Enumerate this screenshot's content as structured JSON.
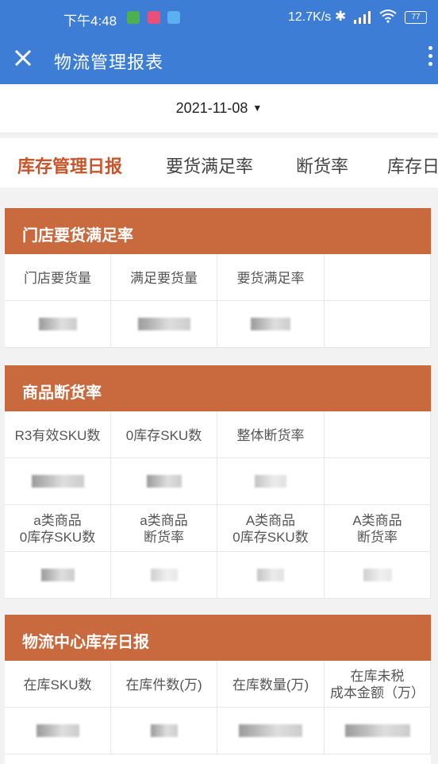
{
  "status_bar": {
    "time": "下午4:48",
    "speed": "12.7K/s",
    "battery": "77",
    "icons": [
      "app-green-icon",
      "app-pink-icon",
      "app-blue-icon",
      "bluetooth-icon",
      "signal-icon",
      "wifi-icon",
      "battery-icon"
    ]
  },
  "app_bar": {
    "title": "物流管理报表",
    "close_icon": "close-icon",
    "more_icon": "more-vertical-icon"
  },
  "date_selector": {
    "value": "2021-11-08",
    "caret": "▼"
  },
  "tabs": [
    {
      "label": "库存管理日报",
      "active": true
    },
    {
      "label": "要货满足率",
      "active": false
    },
    {
      "label": "断货率",
      "active": false
    },
    {
      "label": "库存日",
      "active": false
    }
  ],
  "sections": {
    "store_fill": {
      "title": "门店要货满足率",
      "headers": [
        "门店要货量",
        "满足要货量",
        "要货满足率"
      ]
    },
    "stockout": {
      "title": "商品断货率",
      "headers": [
        "R3有效SKU数",
        "0库存SKU数",
        "整体断货率"
      ],
      "headers2": [
        [
          "a类商品",
          "0库存SKU数"
        ],
        [
          "a类商品",
          "断货率"
        ],
        [
          "A类商品",
          "0库存SKU数"
        ],
        [
          "A类商品",
          "断货率"
        ]
      ]
    },
    "logistics": {
      "title": "物流中心库存日报",
      "headers": [
        "在库SKU数",
        "在库件数(万)",
        "在库数量(万)"
      ],
      "header4": [
        "在库未税",
        "成本金额（万）"
      ]
    }
  },
  "colors": {
    "app_bar": "#3d7dd6",
    "section_header": "#c96a3e",
    "active_tab": "#c8552a"
  }
}
